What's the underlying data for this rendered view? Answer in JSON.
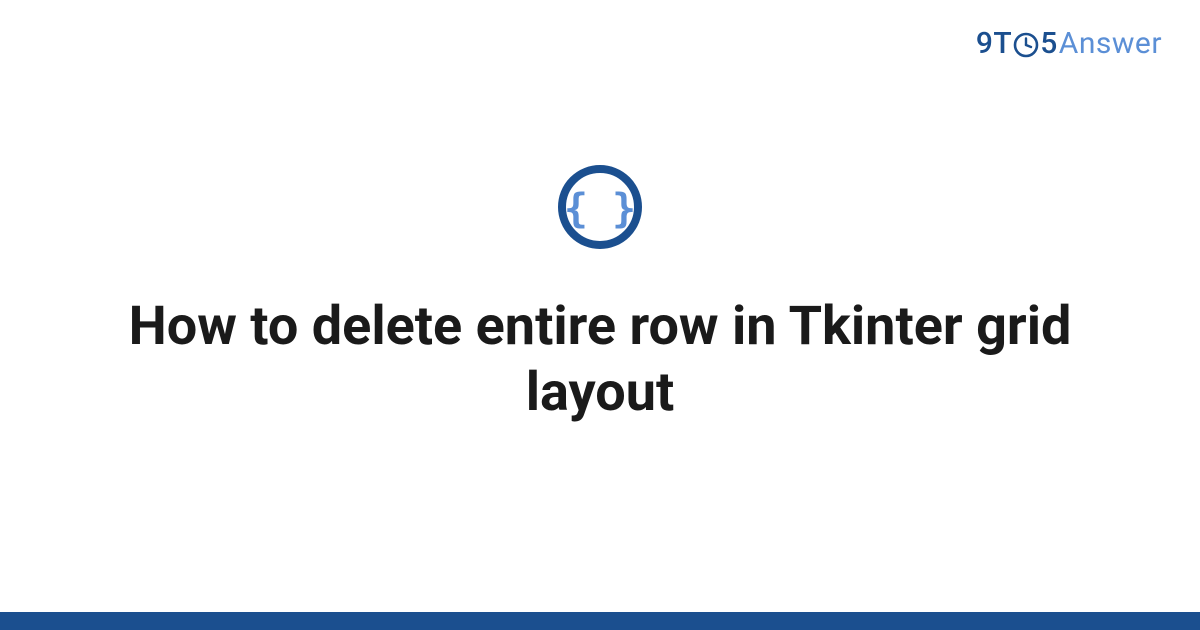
{
  "logo": {
    "part1": "9T",
    "part2": "5",
    "part3": "Answer"
  },
  "badge": {
    "icon_name": "curly-braces-icon"
  },
  "title": "How to delete entire row in Tkinter grid layout",
  "colors": {
    "brand_dark": "#1b4f8f",
    "brand_light": "#5b8fd6",
    "text": "#1a1a1a"
  }
}
